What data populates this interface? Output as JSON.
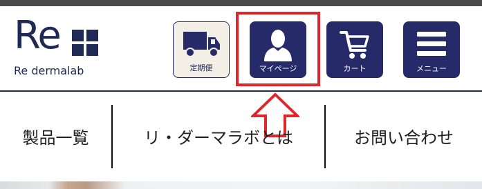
{
  "brand": {
    "logo_text": "Re",
    "subtitle": "Re dermalab"
  },
  "header": {
    "buttons": [
      {
        "label": "定期便",
        "icon": "truck-icon"
      },
      {
        "label": "マイページ",
        "icon": "user-icon"
      },
      {
        "label": "カート",
        "icon": "cart-icon"
      },
      {
        "label": "メニュー",
        "icon": "hamburger-menu-icon"
      }
    ]
  },
  "nav": {
    "items": [
      {
        "label": "製品一覧"
      },
      {
        "label": "リ・ダーマラボとは"
      },
      {
        "label": "お問い合わせ"
      }
    ]
  },
  "annotation": {
    "highlight_color": "#e0262a",
    "arrow_icon": "up-arrow-icon"
  },
  "colors": {
    "brand_navy": "#272a69",
    "subscription_bg": "#f4efe6"
  }
}
